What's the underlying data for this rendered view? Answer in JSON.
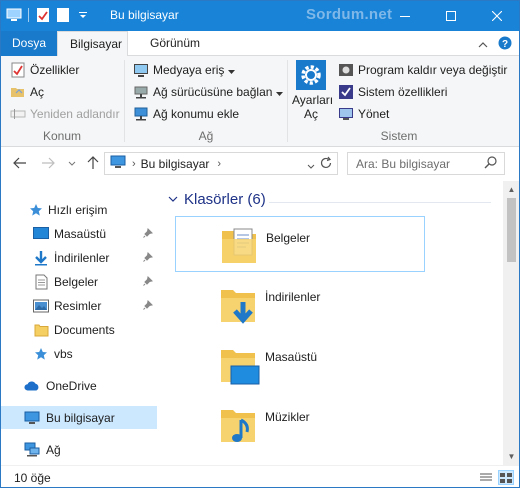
{
  "window": {
    "title": "Bu bilgisayar",
    "watermark": "Sordum.net",
    "accent": "#1883d7"
  },
  "ribbon": {
    "tabs": [
      "Dosya",
      "Bilgisayar",
      "Görünüm"
    ],
    "groups": {
      "konum": {
        "label": "Konum",
        "items": [
          "Özellikler",
          "Aç",
          "Yeniden adlandır"
        ]
      },
      "ag": {
        "label": "Ağ",
        "items": [
          "Medyaya eriş",
          "Ağ sürücüsüne bağlan",
          "Ağ konumu ekle"
        ]
      },
      "sistem": {
        "label": "Sistem",
        "big_button": "Ayarları Aç",
        "big_button_l1": "Ayarları",
        "big_button_l2": "Aç",
        "items": [
          "Program kaldır veya değiştir",
          "Sistem özellikleri",
          "Yönet"
        ]
      }
    }
  },
  "address": {
    "path": "Bu bilgisayar",
    "search_placeholder": "Ara: Bu bilgisayar"
  },
  "nav": {
    "quick_access": "Hızlı erişim",
    "pinned": [
      "Masaüstü",
      "İndirilenler",
      "Belgeler",
      "Resimler"
    ],
    "others": [
      "Documents",
      "vbs"
    ],
    "onedrive": "OneDrive",
    "this_pc": "Bu bilgisayar",
    "network": "Ağ"
  },
  "content": {
    "group_header": "Klasörler (6)",
    "folders": [
      "Belgeler",
      "İndirilenler",
      "Masaüstü",
      "Müzikler"
    ]
  },
  "status": {
    "count": "10 öğe"
  }
}
